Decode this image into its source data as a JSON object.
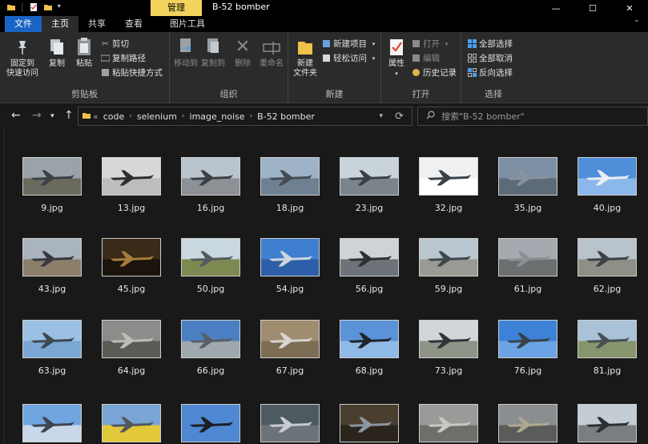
{
  "window": {
    "title": "B-52 bomber",
    "context_tab": "管理",
    "minimize": "—",
    "maximize": "☐",
    "close": "✕"
  },
  "tabs": [
    {
      "label": "文件"
    },
    {
      "label": "主页"
    },
    {
      "label": "共享"
    },
    {
      "label": "查看"
    },
    {
      "label": "图片工具"
    }
  ],
  "ribbon": {
    "clipboard": {
      "label": "剪贴板",
      "pin": "固定到\n快速访问",
      "copy": "复制",
      "paste": "粘贴",
      "cut": "剪切",
      "copy_path": "复制路径",
      "paste_shortcut": "粘贴快捷方式"
    },
    "organize": {
      "label": "组织",
      "move_to": "移动到",
      "copy_to": "复制到",
      "delete": "删除",
      "rename": "重命名"
    },
    "new": {
      "label": "新建",
      "new_folder": "新建\n文件夹",
      "new_item": "新建项目",
      "easy_access": "轻松访问"
    },
    "open": {
      "label": "打开",
      "properties": "属性",
      "open": "打开",
      "edit": "编辑",
      "history": "历史记录"
    },
    "select": {
      "label": "选择",
      "select_all": "全部选择",
      "select_none": "全部取消",
      "invert": "反向选择"
    }
  },
  "address": {
    "prefix": "«",
    "crumbs": [
      "code",
      "selenium",
      "image_noise",
      "B-52 bomber"
    ]
  },
  "search": {
    "placeholder": "搜索\"B-52 bomber\""
  },
  "files": [
    {
      "name": "9.jpg",
      "sky": "#9aa3a8",
      "ground": "#6b6a5e",
      "plane": "#3c4046"
    },
    {
      "name": "13.jpg",
      "sky": "#d8d8d8",
      "ground": "#bdbdbd",
      "plane": "#2e2e2e"
    },
    {
      "name": "16.jpg",
      "sky": "#b9c4cc",
      "ground": "#8c9196",
      "plane": "#3a3f44"
    },
    {
      "name": "18.jpg",
      "sky": "#9fb3c8",
      "ground": "#6f8092",
      "plane": "#444b52"
    },
    {
      "name": "23.jpg",
      "sky": "#c9d3da",
      "ground": "#7b848b",
      "plane": "#3a4046"
    },
    {
      "name": "32.jpg",
      "sky": "#eef0f2",
      "ground": "#ffffff",
      "plane": "#3b4249"
    },
    {
      "name": "35.jpg",
      "sky": "#7d8fa4",
      "ground": "#5d6b78",
      "plane": "#8a939c"
    },
    {
      "name": "40.jpg",
      "sky": "#4f8ed8",
      "ground": "#8bb8ea",
      "plane": "#e9eef3"
    },
    {
      "name": "43.jpg",
      "sky": "#a9b4bd",
      "ground": "#8c7f6a",
      "plane": "#34393e"
    },
    {
      "name": "45.jpg",
      "sky": "#3a2a18",
      "ground": "#1a140c",
      "plane": "#a87c3c"
    },
    {
      "name": "50.jpg",
      "sky": "#c9d7de",
      "ground": "#7c8a52",
      "plane": "#555a5f"
    },
    {
      "name": "54.jpg",
      "sky": "#3f7fd0",
      "ground": "#2d5fa8",
      "plane": "#cfd6dc"
    },
    {
      "name": "56.jpg",
      "sky": "#d0d3d6",
      "ground": "#6d7378",
      "plane": "#2b3035"
    },
    {
      "name": "59.jpg",
      "sky": "#bac7d0",
      "ground": "#9a9a94",
      "plane": "#3f464c"
    },
    {
      "name": "61.jpg",
      "sky": "#a5aab0",
      "ground": "#6c6f70",
      "plane": "#8a8f94"
    },
    {
      "name": "62.jpg",
      "sky": "#b8c3cc",
      "ground": "#8f8f88",
      "plane": "#3d4247"
    },
    {
      "name": "63.jpg",
      "sky": "#9cc0e4",
      "ground": "#7aa7d4",
      "plane": "#3e4850"
    },
    {
      "name": "64.jpg",
      "sky": "#8a8d8a",
      "ground": "#5b5b55",
      "plane": "#bdbdb5"
    },
    {
      "name": "66.jpg",
      "sky": "#4a7fc4",
      "ground": "#9ea8ad",
      "plane": "#585f66"
    },
    {
      "name": "67.jpg",
      "sky": "#a08c6e",
      "ground": "#7e6d55",
      "plane": "#d6d6d0"
    },
    {
      "name": "68.jpg",
      "sky": "#5a93d8",
      "ground": "#8fb9e6",
      "plane": "#1f2428"
    },
    {
      "name": "73.jpg",
      "sky": "#d3d6d8",
      "ground": "#8e9488",
      "plane": "#2f3439"
    },
    {
      "name": "76.jpg",
      "sky": "#3d82d6",
      "ground": "#6ba4e4",
      "plane": "#3a4048"
    },
    {
      "name": "81.jpg",
      "sky": "#a9c2d8",
      "ground": "#87956c",
      "plane": "#484e54"
    },
    {
      "name": "",
      "sky": "#6fa6e0",
      "ground": "#c8d8e8",
      "plane": "#3e4550"
    },
    {
      "name": "",
      "sky": "#7aa4d4",
      "ground": "#e2c93a",
      "plane": "#505860"
    },
    {
      "name": "",
      "sky": "#4f87d2",
      "ground": "#4f87d2",
      "plane": "#1b1e22"
    },
    {
      "name": "",
      "sky": "#4d5a60",
      "ground": "#6c7378",
      "plane": "#c8ccd0"
    },
    {
      "name": "",
      "sky": "#4a3e2e",
      "ground": "#2a241c",
      "plane": "#8c96a0"
    },
    {
      "name": "",
      "sky": "#9a9a98",
      "ground": "#6e6e6a",
      "plane": "#c8c8c4"
    },
    {
      "name": "",
      "sky": "#8a8e90",
      "ground": "#5a5c5a",
      "plane": "#b0a890"
    },
    {
      "name": "",
      "sky": "#c4ccd4",
      "ground": "#7a7e80",
      "plane": "#2a2e32"
    }
  ]
}
